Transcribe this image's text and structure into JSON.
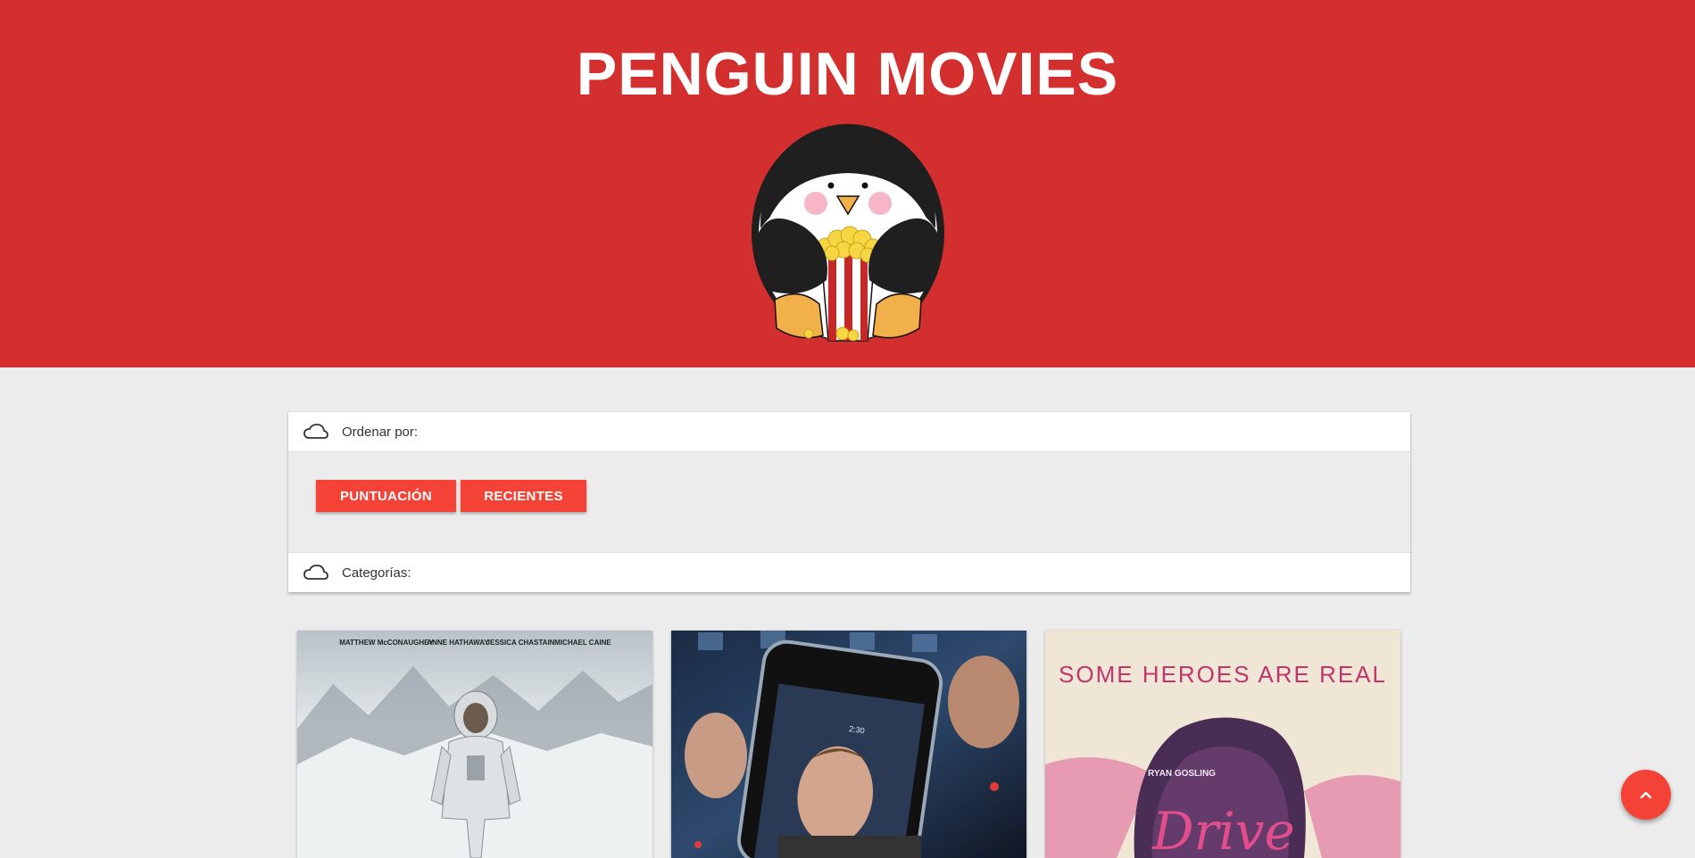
{
  "header": {
    "title": "PENGUIN MOVIES",
    "logo_icon": "penguin-popcorn-logo",
    "background": "#d32f2f"
  },
  "filters": {
    "order_label": "Ordenar por:",
    "order_icon": "cloud-icon",
    "buttons": [
      {
        "label": "PUNTUACIÓN"
      },
      {
        "label": "RECIENTES"
      }
    ],
    "categories_label": "Categorías:",
    "categories_icon": "cloud-icon",
    "button_color": "#f44336"
  },
  "movies": [
    {
      "poster": "interstellar-poster",
      "cast": [
        "MATTHEW McCONAUGHEY",
        "ANNE HATHAWAY",
        "JESSICA CHASTAIN",
        "MICHAEL CAINE"
      ]
    },
    {
      "poster": "phone-thriller-poster",
      "phone_time": "2:30"
    },
    {
      "poster": "drive-poster",
      "tagline": "SOME HEROES ARE REAL",
      "actor": "RYAN GOSLING",
      "title": "Drive"
    }
  ],
  "scroll_top": {
    "icon": "chevron-up-icon"
  }
}
